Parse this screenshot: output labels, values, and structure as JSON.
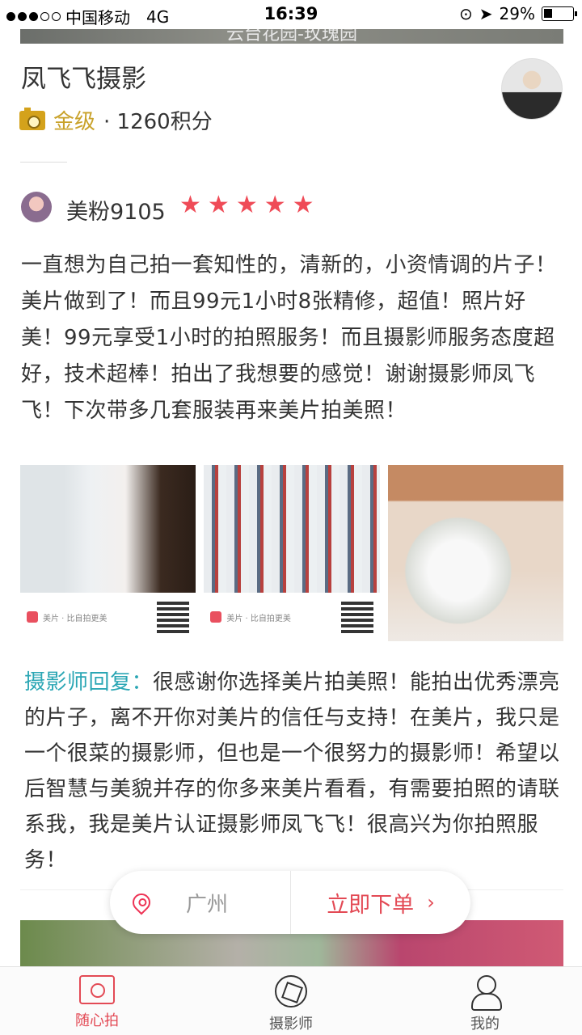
{
  "status_bar": {
    "carrier": "中国移动",
    "network": "4G",
    "time": "16:39",
    "battery_percent": "29%",
    "battery_level": 0.29,
    "signal_bars_filled": 3,
    "signal_bars_total": 5
  },
  "top_banner": {
    "text": "云台花园-玫瑰园"
  },
  "studio": {
    "name": "凤飞飞摄影",
    "level": "金级",
    "points": "· 1260积分"
  },
  "review": {
    "reviewer_name": "美粉9105",
    "rating": 5,
    "text": "一直想为自己拍一套知性的，清新的，小资情调的片子！美片做到了！而且99元1小时8张精修，超值！照片好美！99元享受1小时的拍照服务！而且摄影师服务态度超好，技术超棒！拍出了我想要的感觉！谢谢摄影师凤飞飞！下次带多几套服装再来美片拍美照！",
    "photo_watermark": "美片 · 比自拍更美"
  },
  "reply": {
    "label": "摄影师回复：",
    "text": "很感谢你选择美片拍美照！能拍出优秀漂亮的片子，离不开你对美片的信任与支持！在美片，我只是一个很菜的摄影师，但也是一个很努力的摄影师！希望以后智慧与美貌并存的你多来美片看看，有需要拍照的请联系我，我是美片认证摄影师凤飞飞！很高兴为你拍照服务！"
  },
  "action_bar": {
    "city": "广州",
    "order_label": "立即下单",
    "order_icon": "chevron-right-icon",
    "location_icon": "map-pin-icon"
  },
  "tabs": [
    {
      "label": "随心拍",
      "icon": "camera-frame-icon",
      "active": true
    },
    {
      "label": "摄影师",
      "icon": "aperture-icon",
      "active": false
    },
    {
      "label": "我的",
      "icon": "user-icon",
      "active": false
    }
  ],
  "colors": {
    "accent": "#e34a55",
    "star": "#ef4b57",
    "gold": "#c9a22a",
    "reply_label": "#2aa6b4"
  }
}
